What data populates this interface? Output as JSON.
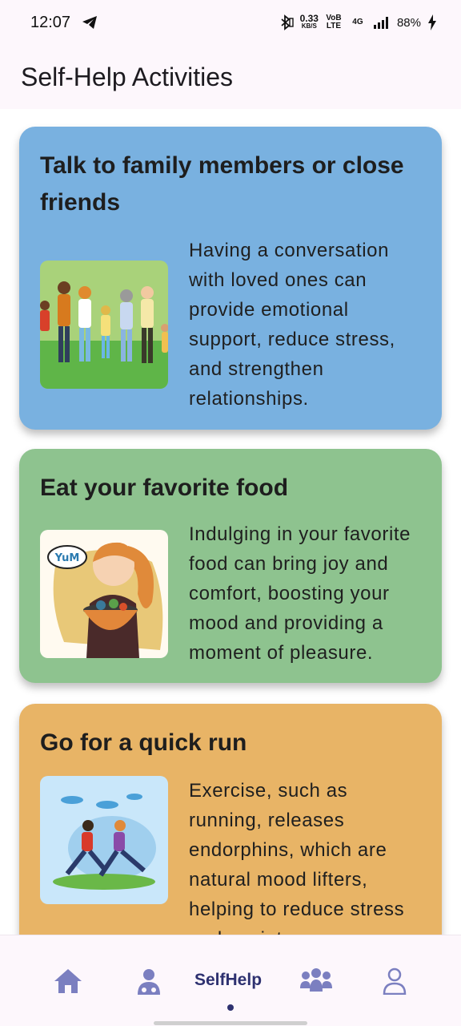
{
  "status": {
    "time": "12:07",
    "speed_value": "0.33",
    "speed_unit": "KB/S",
    "volte": "VoB LTE",
    "network": "4G",
    "battery": "88%"
  },
  "appbar": {
    "title": "Self-Help Activities"
  },
  "cards": [
    {
      "title": "Talk to family members or close friends",
      "description": "Having a conversation with loved ones can provide emotional support, reduce stress, and strengthen relationships.",
      "bg": "#79b1e0"
    },
    {
      "title": "Eat your favorite food",
      "description": "Indulging in your favorite food can bring joy and comfort, boosting your mood and providing a moment of pleasure.",
      "bg": "#8ec38f",
      "image_text": "YuM"
    },
    {
      "title": "Go for a quick run",
      "description": "Exercise, such as running, releases endorphins, which are natural mood lifters, helping to reduce stress and anxiety.",
      "bg": "#e8b466"
    }
  ],
  "nav": {
    "items": [
      {
        "icon": "home-icon"
      },
      {
        "icon": "doctor-icon"
      },
      {
        "label": "SelfHelp"
      },
      {
        "icon": "group-icon"
      },
      {
        "icon": "person-icon"
      }
    ],
    "active_color": "#2e3170",
    "icon_color": "#7b7fc0"
  }
}
